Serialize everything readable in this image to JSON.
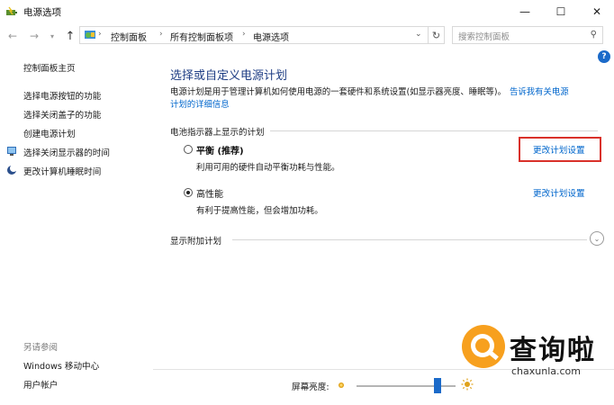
{
  "window": {
    "title": "电源选项",
    "min_glyph": "—",
    "max_glyph": "☐",
    "close_glyph": "✕"
  },
  "nav": {
    "back_glyph": "←",
    "forward_glyph": "→",
    "recent_glyph": "▾",
    "up_glyph": "↑",
    "breadcrumbs": [
      "控制面板",
      "所有控制面板项",
      "电源选项"
    ],
    "separator": "›",
    "dropdown_glyph": "⌄",
    "refresh_glyph": "↻",
    "search_placeholder": "搜索控制面板",
    "search_glyph": "⚲"
  },
  "sidebar": {
    "items": [
      {
        "label": "控制面板主页"
      },
      {
        "label": "选择电源按钮的功能"
      },
      {
        "label": "选择关闭盖子的功能"
      },
      {
        "label": "创建电源计划"
      },
      {
        "label": "选择关闭显示器的时间"
      },
      {
        "label": "更改计算机睡眠时间"
      }
    ],
    "see_also_title": "另请参阅",
    "see_also": [
      {
        "label": "Windows 移动中心"
      },
      {
        "label": "用户帐户"
      }
    ]
  },
  "help_glyph": "?",
  "main": {
    "title": "选择或自定义电源计划",
    "description": "电源计划是用于管理计算机如何使用电源的一套硬件和系统设置(如显示器亮度、睡眠等)。",
    "desc_link_part1": "告诉我有关电源",
    "desc_link_part2": "计划的详细信息",
    "section_label": "电池指示器上显示的计划",
    "plans": [
      {
        "name": "平衡 (推荐)",
        "description": "利用可用的硬件自动平衡功耗与性能。",
        "link": "更改计划设置",
        "selected": false
      },
      {
        "name": "高性能",
        "description": "有利于提高性能，但会增加功耗。",
        "link": "更改计划设置",
        "selected": true
      }
    ],
    "extra_label": "显示附加计划",
    "expand_glyph": "⌄"
  },
  "brightness": {
    "label": "屏幕亮度:",
    "level_percent": 82
  },
  "watermark": {
    "text": "查询啦",
    "domain": "chaxunla.com"
  },
  "colors": {
    "link": "#0066cc",
    "title": "#1e3d84",
    "highlight": "#d9312a",
    "slider": "#1b6ac9",
    "watermark": "#f7a01e"
  }
}
